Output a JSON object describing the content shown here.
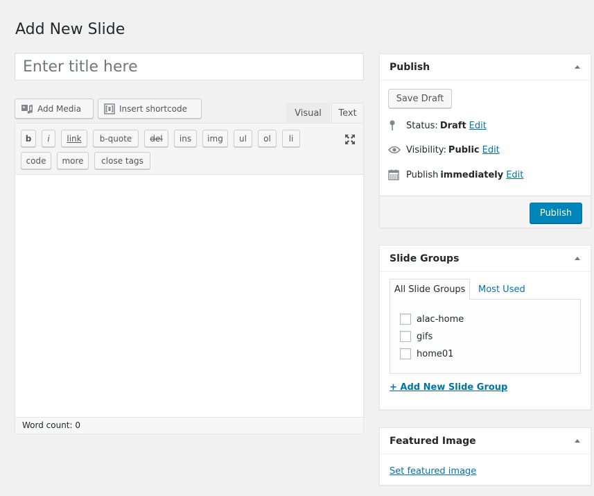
{
  "page": {
    "title": "Add New Slide"
  },
  "title_field": {
    "placeholder": "Enter title here"
  },
  "media_buttons": {
    "add_media": "Add Media",
    "insert_shortcode": "Insert shortcode"
  },
  "editor_tabs": {
    "visual": "Visual",
    "text": "Text",
    "active": "Text"
  },
  "quicktags": [
    "b",
    "i",
    "link",
    "b-quote",
    "del",
    "ins",
    "img",
    "ul",
    "ol",
    "li",
    "code",
    "more",
    "close tags"
  ],
  "editor": {
    "content": "",
    "word_count": "Word count: 0"
  },
  "publish_box": {
    "title": "Publish",
    "save_draft": "Save Draft",
    "status_label": "Status:",
    "status_value": "Draft",
    "visibility_label": "Visibility:",
    "visibility_value": "Public",
    "publish_label": "Publish",
    "publish_value": "immediately",
    "edit_link": "Edit",
    "publish_button": "Publish"
  },
  "slide_groups_box": {
    "title": "Slide Groups",
    "tabs": [
      "All Slide Groups",
      "Most Used"
    ],
    "active_tab": "All Slide Groups",
    "groups": [
      {
        "label": "alac-home",
        "checked": false
      },
      {
        "label": "gifs",
        "checked": false
      },
      {
        "label": "home01",
        "checked": false
      }
    ],
    "add_new_link": "+ Add New Slide Group"
  },
  "featured_image_box": {
    "title": "Featured Image",
    "set_link": "Set featured image"
  },
  "colors": {
    "primary_button": "#0085ba",
    "link": "#0073aa",
    "background": "#f1f1f1"
  },
  "icons": {
    "add_media": "media-icon",
    "insert_shortcode": "shortcode-icon",
    "fullscreen": "fullscreen-icon",
    "status": "pin-icon",
    "visibility": "eye-icon",
    "publish_date": "calendar-icon",
    "collapse": "caret-up-icon"
  }
}
